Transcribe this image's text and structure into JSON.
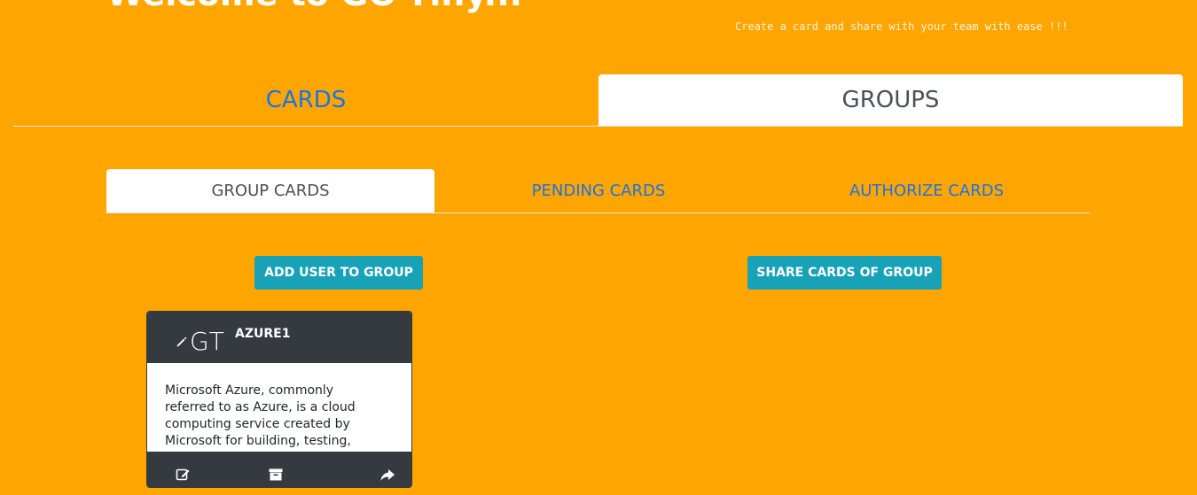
{
  "header": {
    "welcome_title": "Welcome to GO-Tiny...",
    "tagline": "Create a card and share with your team with ease !!!"
  },
  "main_tabs": [
    {
      "label": "CARDS",
      "active": false
    },
    {
      "label": "GROUPS",
      "active": true
    }
  ],
  "sub_tabs": [
    {
      "label": "GROUP CARDS",
      "active": true
    },
    {
      "label": "PENDING CARDS",
      "active": false
    },
    {
      "label": "AUTHORIZE CARDS",
      "active": false
    }
  ],
  "actions": {
    "add_user_label": "ADD USER TO GROUP",
    "share_cards_label": "SHARE CARDS OF GROUP"
  },
  "card": {
    "logo_text": "GT",
    "title": "AZURE1",
    "body": "Microsoft Azure, commonly referred to as Azure, is a cloud computing service created by Microsoft for building, testing,",
    "footer_icons": [
      "edit-icon",
      "archive-icon",
      "share-icon"
    ]
  },
  "colors": {
    "page_background": "#FFA500",
    "link_blue": "#1a73e8",
    "button_teal": "#17a2b8",
    "card_dark": "#343a40"
  }
}
